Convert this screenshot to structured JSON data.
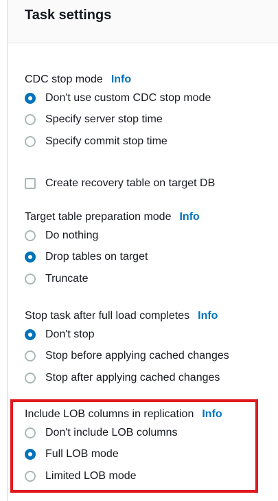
{
  "header": {
    "title": "Task settings"
  },
  "cdc_stop_mode": {
    "label": "CDC stop mode",
    "info": "Info",
    "options": [
      {
        "label": "Don't use custom CDC stop mode",
        "checked": true
      },
      {
        "label": "Specify server stop time",
        "checked": false
      },
      {
        "label": "Specify commit stop time",
        "checked": false
      }
    ]
  },
  "recovery_table": {
    "label": "Create recovery table on target DB",
    "checked": false
  },
  "target_prep_mode": {
    "label": "Target table preparation mode",
    "info": "Info",
    "options": [
      {
        "label": "Do nothing",
        "checked": false
      },
      {
        "label": "Drop tables on target",
        "checked": true
      },
      {
        "label": "Truncate",
        "checked": false
      }
    ]
  },
  "stop_after_full_load": {
    "label": "Stop task after full load completes",
    "info": "Info",
    "options": [
      {
        "label": "Don't stop",
        "checked": true
      },
      {
        "label": "Stop before applying cached changes",
        "checked": false
      },
      {
        "label": "Stop after applying cached changes",
        "checked": false
      }
    ]
  },
  "lob_columns": {
    "label": "Include LOB columns in replication",
    "info": "Info",
    "options": [
      {
        "label": "Don't include LOB columns",
        "checked": false
      },
      {
        "label": "Full LOB mode",
        "checked": true
      },
      {
        "label": "Limited LOB mode",
        "checked": false
      }
    ]
  },
  "colors": {
    "accent": "#0073bb",
    "highlight": "#e0191f",
    "unchecked_border": "#aab7b8"
  }
}
